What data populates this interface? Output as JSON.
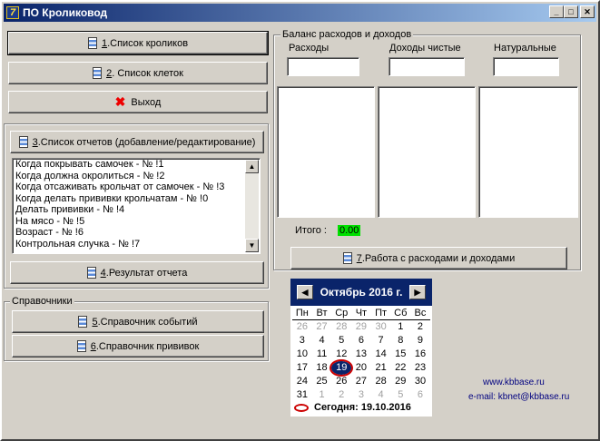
{
  "window": {
    "title": "ПО Кроликовод",
    "logo": "7"
  },
  "buttons": {
    "rabbits": {
      "num": "1",
      "label": ".Список кроликов"
    },
    "cages": {
      "num": "2",
      "label": ". Список клеток"
    },
    "exit": {
      "label": "Выход"
    },
    "reports": {
      "num": "3",
      "label": ".Список отчетов (добавление/редактирование)"
    },
    "result": {
      "num": "4",
      "label": ".Результат отчета"
    },
    "events": {
      "num": "5",
      "label": ".Справочник событий"
    },
    "vaccines": {
      "num": "6",
      "label": ".Справочник прививок"
    },
    "expenses": {
      "num": "7",
      "label": ".Работа с расходами и доходами"
    }
  },
  "reports_list": [
    "Когда покрывать самочек - № !1",
    "Когда должна окролиться - № !2",
    "Когда отсаживать крольчат от самочек - № !3",
    "Когда делать прививки крольчатам - № !0",
    "Делать прививки - № !4",
    "На мясо - № !5",
    "Возраст - № !6",
    "Контрольная случка - № !7"
  ],
  "reference": {
    "title": "Справочники"
  },
  "balance": {
    "title": "Баланс расходов и доходов",
    "col_expenses": "Расходы",
    "col_income": "Доходы чистые",
    "col_natural": "Натуральные",
    "total_label": "Итого :",
    "total_value": "0.00"
  },
  "calendar": {
    "month": "Октябрь 2016 г.",
    "weekdays": [
      "Пн",
      "Вт",
      "Ср",
      "Чт",
      "Пт",
      "Сб",
      "Вс"
    ],
    "weeks": [
      [
        [
          "26",
          1
        ],
        [
          "27",
          1
        ],
        [
          "28",
          1
        ],
        [
          "29",
          1
        ],
        [
          "30",
          1
        ],
        [
          "1",
          0
        ],
        [
          "2",
          0
        ]
      ],
      [
        [
          "3",
          0
        ],
        [
          "4",
          0
        ],
        [
          "5",
          0
        ],
        [
          "6",
          0
        ],
        [
          "7",
          0
        ],
        [
          "8",
          0
        ],
        [
          "9",
          0
        ]
      ],
      [
        [
          "10",
          0
        ],
        [
          "11",
          0
        ],
        [
          "12",
          0
        ],
        [
          "13",
          0
        ],
        [
          "14",
          0
        ],
        [
          "15",
          0
        ],
        [
          "16",
          0
        ]
      ],
      [
        [
          "17",
          0
        ],
        [
          "18",
          0
        ],
        [
          "19",
          2
        ],
        [
          "20",
          0
        ],
        [
          "21",
          0
        ],
        [
          "22",
          0
        ],
        [
          "23",
          0
        ]
      ],
      [
        [
          "24",
          0
        ],
        [
          "25",
          0
        ],
        [
          "26",
          0
        ],
        [
          "27",
          0
        ],
        [
          "28",
          0
        ],
        [
          "29",
          0
        ],
        [
          "30",
          0
        ]
      ],
      [
        [
          "31",
          0
        ],
        [
          "1",
          1
        ],
        [
          "2",
          1
        ],
        [
          "3",
          1
        ],
        [
          "4",
          1
        ],
        [
          "5",
          1
        ],
        [
          "6",
          1
        ]
      ]
    ],
    "today_text": "Сегодня: 19.10.2016"
  },
  "links": {
    "site": "www.kbbase.ru",
    "email": "e-mail: kbnet@kbbase.ru"
  }
}
